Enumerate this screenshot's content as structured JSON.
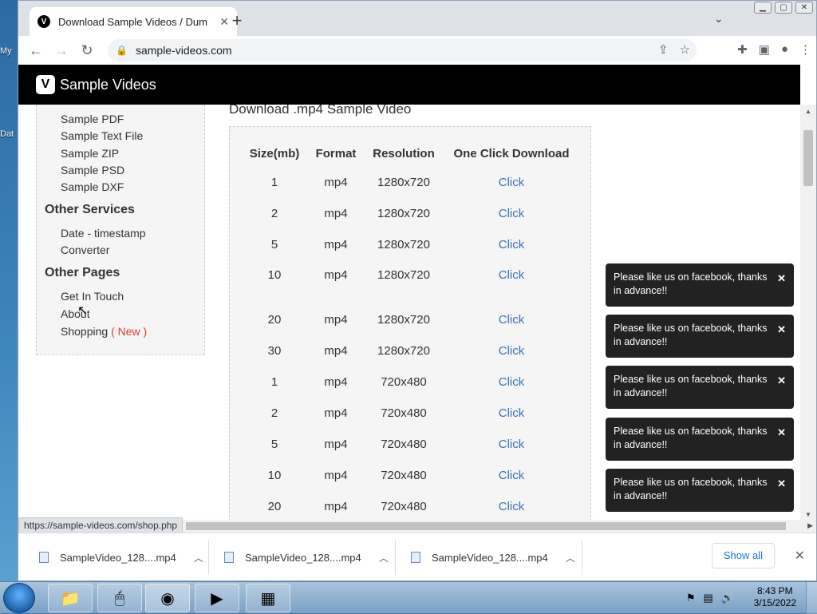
{
  "desktop": {
    "icons": [
      {
        "label": "My"
      },
      {
        "label": "Dat"
      }
    ]
  },
  "browser": {
    "tab_title": "Download Sample Videos / Dum",
    "favicon_letter": "V",
    "url": "sample-videos.com",
    "status_url": "https://sample-videos.com/shop.php"
  },
  "site": {
    "logo_letter": "V",
    "brand": "Sample Videos"
  },
  "sidebar": {
    "links_top": [
      "Sample PDF",
      "Sample Text File",
      "Sample ZIP",
      "Sample PSD",
      "Sample DXF"
    ],
    "other_services_heading": "Other Services",
    "other_services": [
      "Date - timestamp",
      "Converter"
    ],
    "other_pages_heading": "Other Pages",
    "other_pages": [
      "Get In Touch",
      "About"
    ],
    "shopping": "Shopping",
    "shopping_badge": "( New )"
  },
  "main": {
    "title": "Download .mp4 Sample Video",
    "table": {
      "headers": [
        "Size(mb)",
        "Format",
        "Resolution",
        "One Click Download"
      ],
      "rows": [
        [
          "1",
          "mp4",
          "1280x720",
          "Click"
        ],
        [
          "2",
          "mp4",
          "1280x720",
          "Click"
        ],
        [
          "5",
          "mp4",
          "1280x720",
          "Click"
        ],
        [
          "10",
          "mp4",
          "1280x720",
          "Click"
        ],
        [
          "20",
          "mp4",
          "1280x720",
          "Click"
        ],
        [
          "30",
          "mp4",
          "1280x720",
          "Click"
        ],
        [
          "1",
          "mp4",
          "720x480",
          "Click"
        ],
        [
          "2",
          "mp4",
          "720x480",
          "Click"
        ],
        [
          "5",
          "mp4",
          "720x480",
          "Click"
        ],
        [
          "10",
          "mp4",
          "720x480",
          "Click"
        ],
        [
          "20",
          "mp4",
          "720x480",
          "Click"
        ]
      ]
    }
  },
  "toasts": [
    "Please like us on facebook, thanks in advance!!",
    "Please like us on facebook, thanks in advance!!",
    "Please like us on facebook, thanks in advance!!",
    "Please like us on facebook, thanks in advance!!",
    "Please like us on facebook, thanks in advance!!"
  ],
  "downloads": {
    "items": [
      "SampleVideo_128....mp4",
      "SampleVideo_128....mp4",
      "SampleVideo_128....mp4"
    ],
    "show_all": "Show all"
  },
  "taskbar": {
    "time": "8:43 PM",
    "date": "3/15/2022"
  }
}
